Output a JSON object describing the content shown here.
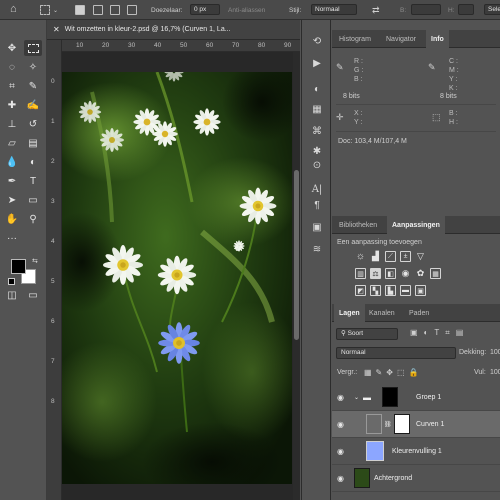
{
  "options_bar": {
    "home_icon": "home-icon",
    "feather_label": "Doezelaar:",
    "feather_value": "0 px",
    "antialias_label": "Anti-aliassen",
    "style_label": "Stijl:",
    "style_value": "Normaal",
    "select_label": "Sele"
  },
  "document": {
    "tab_title": "Wit omzetten in kleur-2.psd @ 16,7% (Curven 1, La..."
  },
  "rulers": {
    "h": [
      "10",
      "20",
      "30",
      "40",
      "50",
      "60",
      "70",
      "80",
      "90"
    ],
    "v": [
      "0",
      "1",
      "2",
      "3",
      "4",
      "5",
      "6",
      "7",
      "8"
    ]
  },
  "info_panel": {
    "tabs": [
      "Histogram",
      "Navigator",
      "Info"
    ],
    "active_tab": "Info",
    "rgb": [
      "R :",
      "G :",
      "B :"
    ],
    "cmyk": [
      "C :",
      "M :",
      "Y :",
      "K :"
    ],
    "bits_left": "8 bits",
    "bits_right": "8 bits",
    "xy": [
      "X :",
      "Y :"
    ],
    "wh": [
      "B :",
      "H :"
    ],
    "doc": "Doc: 103,4 M/107,4 M"
  },
  "adjust_panel": {
    "tabs": [
      "Bibliotheken",
      "Aanpassingen"
    ],
    "active_tab": "Aanpassingen",
    "add_label": "Een aanpassing toevoegen"
  },
  "layers_panel": {
    "tabs": [
      "Lagen",
      "Kanalen",
      "Paden"
    ],
    "active_tab": "Lagen",
    "filter_value": "Soort",
    "blend_value": "Normaal",
    "opacity_label": "Dekking:",
    "opacity_value": "100",
    "lock_label": "Vergr.:",
    "fill_label": "Vul:",
    "fill_value": "100",
    "layers": [
      {
        "name": "Groep 1"
      },
      {
        "name": "Curven 1"
      },
      {
        "name": "Kleurenvulling 1"
      },
      {
        "name": "Achtergrond"
      }
    ]
  },
  "colors": {
    "accent": "#3b8cd9",
    "panel": "#535353",
    "dark": "#282828",
    "fill_layer": "#8ca6ff"
  }
}
